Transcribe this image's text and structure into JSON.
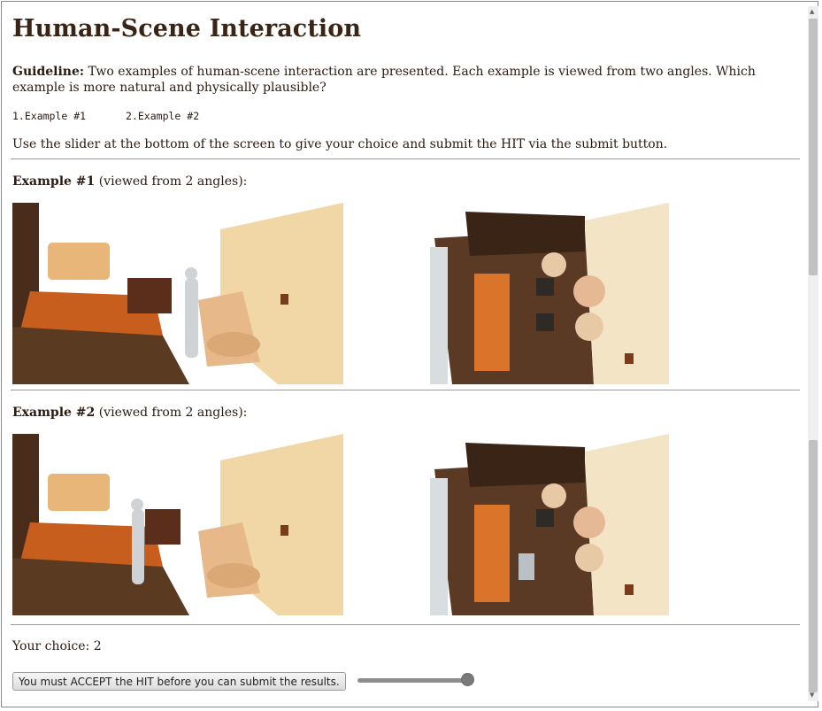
{
  "page": {
    "title": "Human-Scene Interaction",
    "guideline_label": "Guideline:",
    "guideline_text": "Two examples of human-scene interaction are presented. Each example is viewed from two angles. Which example is more natural and physically plausible?",
    "options": [
      "1.Example #1",
      "2.Example #2"
    ],
    "instruction": "Use the slider at the bottom of the screen to give your choice and submit the HIT via the submit button."
  },
  "examples": [
    {
      "label": "Example #1",
      "subtitle": "(viewed from 2 angles):"
    },
    {
      "label": "Example #2",
      "subtitle": "(viewed from 2 angles):"
    }
  ],
  "choice": {
    "label": "Your choice:",
    "value": "2"
  },
  "submit": {
    "label": "You must ACCEPT the HIT before you can submit the results."
  },
  "slider": {
    "value": 2,
    "min": 1,
    "max": 2
  },
  "colors": {
    "accent_orange": "#d9742a",
    "wall_cream": "#f2d7a6",
    "dark_brown": "#3a2416"
  },
  "icons": {
    "scroll_up": "scroll-up-arrow-icon",
    "scroll_down": "scroll-down-arrow-icon"
  }
}
